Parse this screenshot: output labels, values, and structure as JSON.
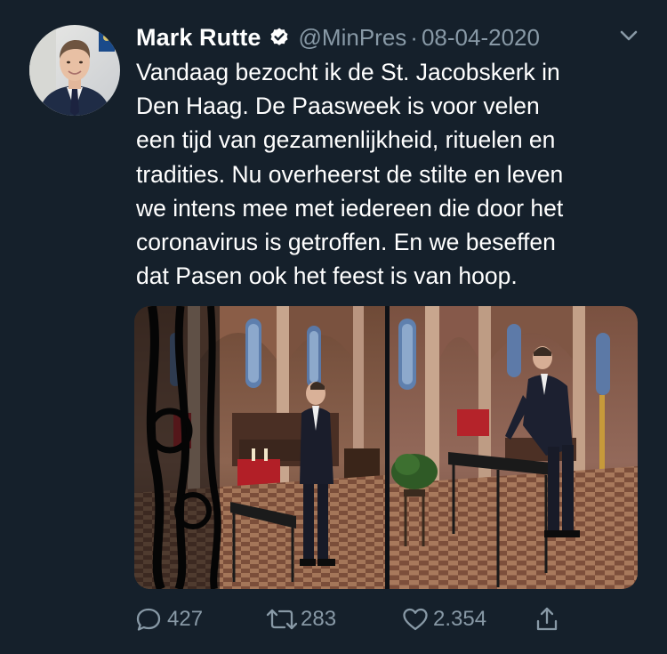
{
  "tweet": {
    "author": {
      "name": "Mark Rutte",
      "handle": "@MinPres",
      "verified_icon": "verified-badge-icon",
      "avatar_icon": "profile-avatar"
    },
    "separator": "·",
    "date": "08-04-2020",
    "menu_icon": "chevron-down-icon",
    "text_lines": [
      "Vandaag bezocht ik de St. Jacobskerk in",
      "Den Haag. De Paasweek is voor velen",
      "een tijd van gezamenlijkheid, rituelen en",
      "tradities. Nu overheerst de stilte en leven",
      "we intens mee met iedereen die door het",
      "coronavirus is getroffen. En we beseffen",
      "dat Pasen ook het feest is van hoop."
    ],
    "media": {
      "photos": [
        "church-photo-left",
        "church-photo-right"
      ]
    },
    "actions": {
      "reply": {
        "icon": "reply-icon",
        "count": "427"
      },
      "retweet": {
        "icon": "retweet-icon",
        "count": "283"
      },
      "like": {
        "icon": "heart-icon",
        "count": "2.354"
      },
      "share": {
        "icon": "share-icon"
      }
    }
  },
  "colors": {
    "background": "#15202b",
    "text": "#ffffff",
    "secondary": "#8899a6"
  }
}
